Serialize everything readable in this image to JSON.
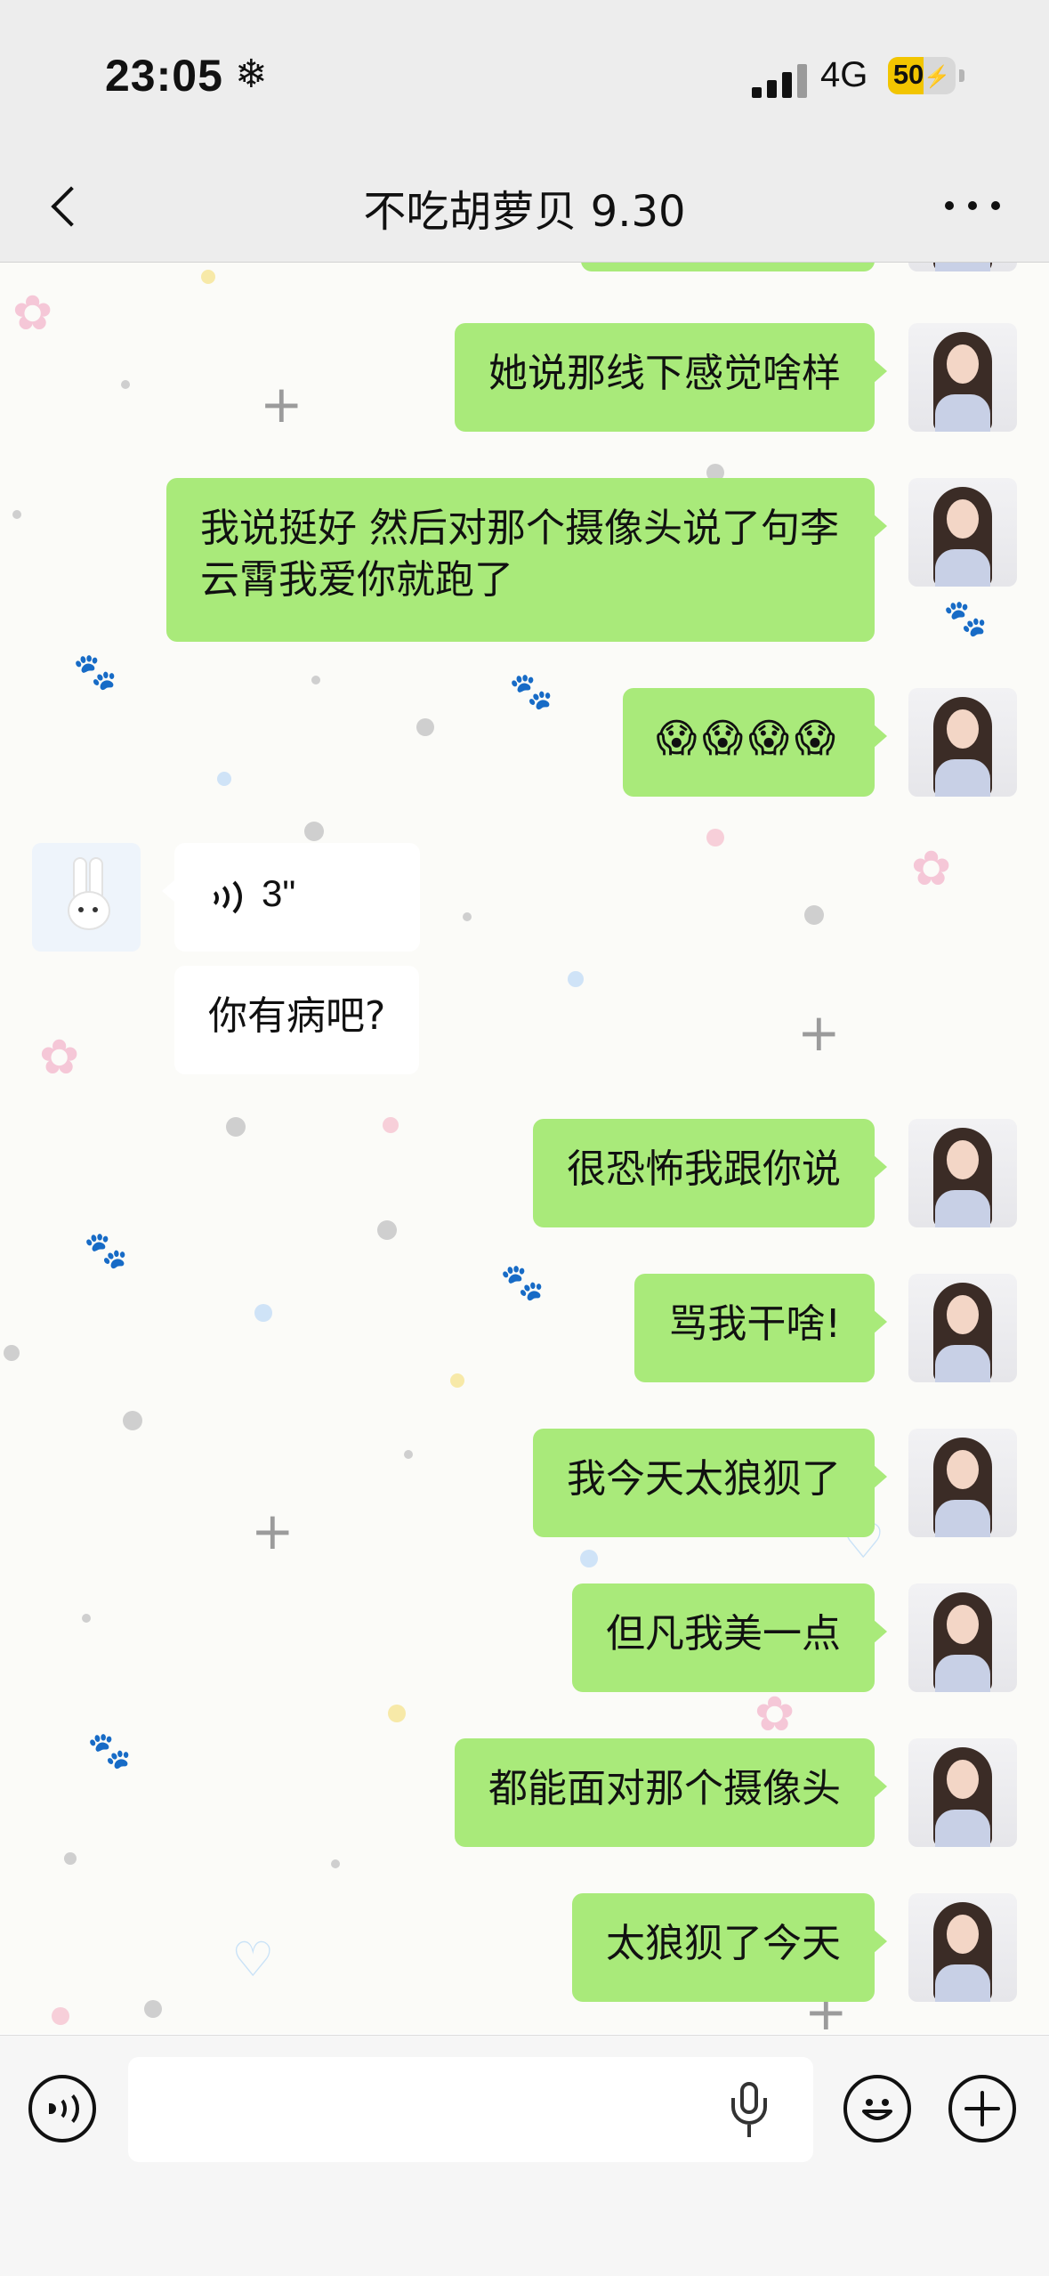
{
  "status_bar": {
    "time": "23:05",
    "time_icon": "❄",
    "network": "4G",
    "battery": "50",
    "battery_level": 0.5
  },
  "header": {
    "title": "不吃胡萝贝 9.30"
  },
  "messages": [
    {
      "sender": "me",
      "text": "她说那线下感觉啥样"
    },
    {
      "sender": "me",
      "text": "我说挺好 然后对那个摄像头说了句李云霄我爱你就跑了"
    },
    {
      "sender": "me",
      "text": "😱😱😱😱"
    },
    {
      "sender": "other",
      "type": "voice",
      "text": "3\""
    },
    {
      "sender": "other",
      "text": "你有病吧?"
    },
    {
      "sender": "me",
      "text": "很恐怖我跟你说"
    },
    {
      "sender": "me",
      "text": "骂我干啥!"
    },
    {
      "sender": "me",
      "text": "我今天太狼狈了"
    },
    {
      "sender": "me",
      "text": "但凡我美一点"
    },
    {
      "sender": "me",
      "text": "都能面对那个摄像头"
    },
    {
      "sender": "me",
      "text": "太狼狈了今天"
    }
  ],
  "input": {
    "placeholder": ""
  },
  "colors": {
    "my_bubble": "#a9ea7a",
    "other_bubble": "#ffffff",
    "bar_background": "#ededed"
  },
  "icons": {
    "back": "chevron-left-icon",
    "more": "more-dots-icon",
    "voice_toggle": "voice-icon",
    "mic": "microphone-icon",
    "emoji": "emoji-icon",
    "plus": "plus-icon"
  }
}
